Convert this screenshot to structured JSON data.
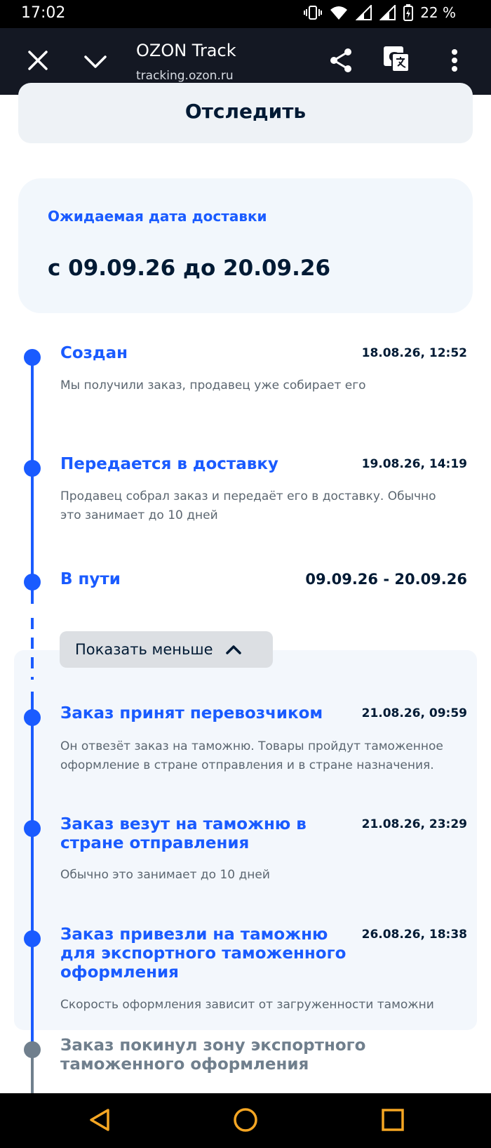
{
  "status_bar": {
    "time": "17:02",
    "battery": "22 %"
  },
  "browser": {
    "title": "OZON Track",
    "url": "tracking.ozon.ru"
  },
  "track_button_label": "Отследить",
  "delivery": {
    "label": "Ожидаемая дата доставки",
    "range": "с 09.09.26 до 20.09.26"
  },
  "events": [
    {
      "title": "Создан",
      "date": "18.08.26, 12:52",
      "description": "Мы получили заказ, продавец уже собирает его"
    },
    {
      "title": "Передается в доставку",
      "date": "19.08.26, 14:19",
      "description_line1": "Продавец собрал заказ и передаёт его в доставку. Обычно",
      "description_line2": "это занимает до 10 дней"
    },
    {
      "title": "В пути",
      "date": "09.09.26 - 20.09.26"
    }
  ],
  "show_less_label": "Показать меньше",
  "sub_events": [
    {
      "title": "Заказ принят перевозчиком",
      "date": "21.08.26, 09:59",
      "description_line1": "Он отвезёт заказ на таможню. Товары пройдут таможенное",
      "description_line2": "оформление в стране отправления и в стране назначения."
    },
    {
      "title_line1": "Заказ везут на таможню в",
      "title_line2": "стране отправления",
      "date": "21.08.26, 23:29",
      "description": "Обычно это занимает до 10 дней"
    },
    {
      "title_line1": "Заказ привезли на таможню",
      "title_line2": "для экспортного таможенного",
      "title_line3": "оформления",
      "date": "26.08.26, 18:38",
      "description": "Скорость оформления зависит от загруженности таможни"
    }
  ],
  "pending_event": {
    "title_line1": "Заказ покинул зону экспортного",
    "title_line2": "таможенного оформления"
  },
  "colors": {
    "accent": "#1a5bff",
    "text": "#001a34",
    "muted": "#707f8d",
    "card": "#f2f7fc"
  }
}
